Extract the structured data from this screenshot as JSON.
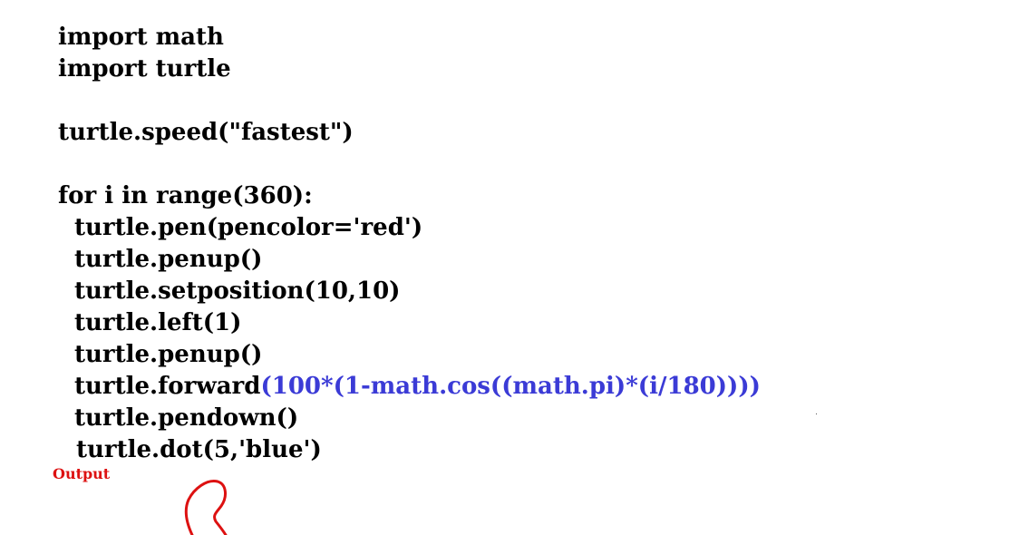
{
  "code": {
    "line1": "import math",
    "line2": "import turtle",
    "line3": "turtle.speed(\"fastest\")",
    "line4": "for i in range(360):",
    "line5": "turtle.pen(pencolor='red')",
    "line6": "turtle.penup()",
    "line7": "turtle.setposition(10,10)",
    "line8": "turtle.left(1)",
    "line9": "turtle.penup()",
    "line10_prefix": "turtle.forward",
    "line10_highlight": "(100*(1-math.cos((math.pi)*(i/180))))",
    "line11": "turtle.pendown()",
    "line12": "turtle.dot(5,'blue')"
  },
  "output": {
    "label": "Output"
  },
  "colors": {
    "text": "#000000",
    "highlight": "#3b3bd6",
    "output_label": "#dd1111",
    "output_curve": "#dd1111",
    "background": "#ffffff"
  }
}
